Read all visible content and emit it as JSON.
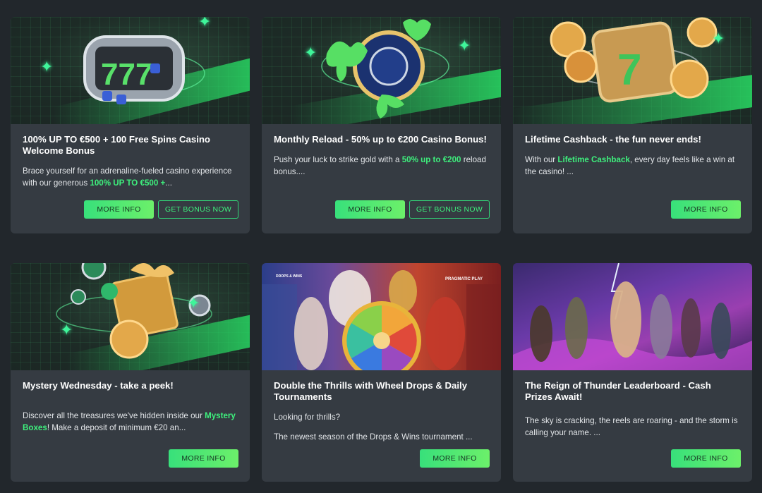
{
  "cards": [
    {
      "title": "100% UP TO €500 + 100 Free Spins Casino Welcome Bonus",
      "desc_parts": [
        "Brace yourself for an adrenaline-fueled casino experience with our generous ",
        "100% UP TO €500 +",
        "..."
      ],
      "more_info": "MORE INFO",
      "get_bonus": "GET BONUS NOW",
      "image": "slot-machine-777-icon"
    },
    {
      "title": "Monthly Reload - 50% up to €200 Casino Bonus!",
      "desc_parts": [
        "Push your luck to strike gold with a ",
        "50% up to €200",
        " reload bonus...."
      ],
      "more_info": "MORE INFO",
      "get_bonus": "GET BONUS NOW",
      "image": "casino-chip-icon"
    },
    {
      "title": "Lifetime Cashback - the fun never ends!",
      "desc_parts": [
        "With our ",
        "Lifetime Cashback",
        ", every day feels like a win at the casino!  ..."
      ],
      "more_info": "MORE INFO",
      "image": "calendar-coins-icon"
    },
    {
      "title": "Mystery Wednesday - take a peek!",
      "desc_parts": [
        "Discover all the treasures we've hidden inside our ",
        "Mystery Boxes",
        "! Make a deposit of minimum €20 an..."
      ],
      "more_info": "MORE INFO",
      "image": "gift-box-icon"
    },
    {
      "title": "Double the Thrills with Wheel Drops & Daily Tournaments",
      "desc_line1": "Looking for thrills?",
      "desc_line2": "The newest season of the Drops & Wins tournament ...",
      "more_info": "MORE INFO",
      "image": "prize-wheel-icon",
      "badge_left": "DROPS & WINS",
      "badge_right": "PRAGMATIC PLAY"
    },
    {
      "title": "The Reign of Thunder Leaderboard - Cash Prizes Await!",
      "desc_parts": [
        "The sky is cracking, the reels are roaring - and the storm is calling your name. ..."
      ],
      "more_info": "MORE INFO",
      "image": "thunder-gods-icon"
    }
  ],
  "colors": {
    "page_bg": "#22272c",
    "card_bg": "#353b42",
    "accent_green": "#3ef07d"
  }
}
